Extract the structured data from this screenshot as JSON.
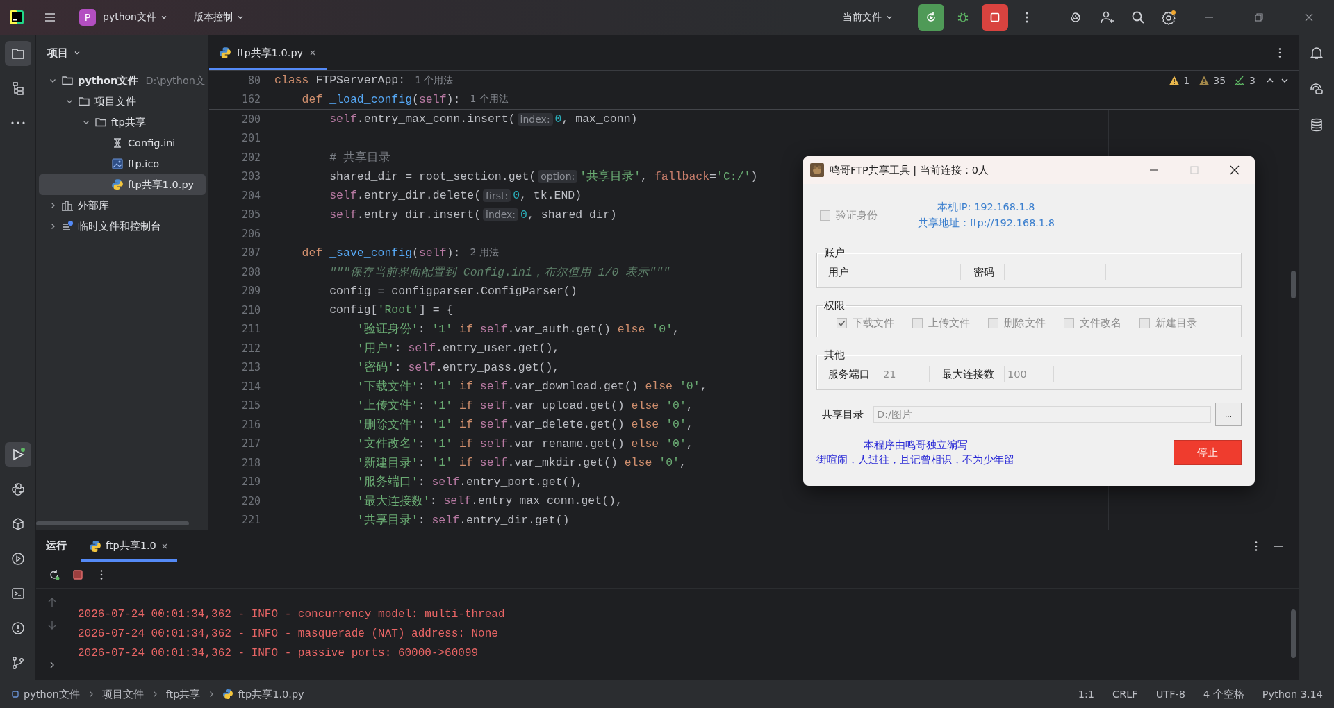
{
  "topbar": {
    "project_badge": "P",
    "project": "python文件",
    "vcs": "版本控制",
    "run_config": "当前文件"
  },
  "project_panel": {
    "title": "项目",
    "tree": [
      {
        "label": "python文件",
        "path": "D:\\python文",
        "kind": "folder",
        "bold": true,
        "expanded": true,
        "selected": false,
        "children": [
          {
            "label": "项目文件",
            "kind": "folder",
            "expanded": true,
            "selected": false,
            "children": [
              {
                "label": "ftp共享",
                "kind": "folder",
                "expanded": true,
                "selected": false,
                "children": [
                  {
                    "label": "Config.ini",
                    "kind": "ini",
                    "selected": false
                  },
                  {
                    "label": "ftp.ico",
                    "kind": "image",
                    "selected": false
                  },
                  {
                    "label": "ftp共享1.0.py",
                    "kind": "python",
                    "selected": true
                  }
                ]
              }
            ]
          }
        ]
      },
      {
        "label": "外部库",
        "kind": "library",
        "expanded": false,
        "selected": false
      },
      {
        "label": "临时文件和控制台",
        "kind": "scratch",
        "expanded": false,
        "selected": false
      }
    ]
  },
  "editor": {
    "tabs": [
      {
        "label": "ftp共享1.0.py",
        "selected": true
      }
    ],
    "inspections": {
      "errors": "1",
      "warnings": "35",
      "typos": "3"
    },
    "sticky_lines": [
      {
        "number": "80",
        "tokens": [
          {
            "kind": "kw",
            "text": "class"
          },
          {
            "kind": "plain",
            "text": " FTPServerApp:"
          },
          {
            "kind": "usage",
            "text": "1 个用法"
          }
        ]
      },
      {
        "number": "162",
        "tokens": [
          {
            "kind": "kw",
            "text": "    def "
          },
          {
            "kind": "fn",
            "text": "_load_config"
          },
          {
            "kind": "plain",
            "text": "("
          },
          {
            "kind": "self",
            "text": "self"
          },
          {
            "kind": "plain",
            "text": "):"
          },
          {
            "kind": "usage",
            "text": "1 个用法"
          }
        ]
      }
    ],
    "lines": [
      {
        "number": "200",
        "tokens": [
          {
            "kind": "self",
            "text": "        self"
          },
          {
            "kind": "plain",
            "text": ".entry_max_conn.insert("
          },
          {
            "kind": "hint",
            "text": "index:"
          },
          {
            "kind": "num",
            "text": "0"
          },
          {
            "kind": "plain",
            "text": ", max_conn)"
          }
        ]
      },
      {
        "number": "201"
      },
      {
        "number": "202",
        "tokens": [
          {
            "kind": "comment",
            "text": "        # 共享目录"
          }
        ]
      },
      {
        "number": "203",
        "tokens": [
          {
            "kind": "plain",
            "text": "        shared_dir = root_section.get("
          },
          {
            "kind": "hint",
            "text": "option:"
          },
          {
            "kind": "str",
            "text": "'共享目录'"
          },
          {
            "kind": "plain",
            "text": ", "
          },
          {
            "kind": "param",
            "text": "fallback"
          },
          {
            "kind": "plain",
            "text": "="
          },
          {
            "kind": "str",
            "text": "'C:/'"
          },
          {
            "kind": "plain",
            "text": ")"
          }
        ]
      },
      {
        "number": "204",
        "tokens": [
          {
            "kind": "self",
            "text": "        self"
          },
          {
            "kind": "plain",
            "text": ".entry_dir.delete("
          },
          {
            "kind": "hint",
            "text": "first:"
          },
          {
            "kind": "num",
            "text": "0"
          },
          {
            "kind": "plain",
            "text": ", tk.END)"
          }
        ]
      },
      {
        "number": "205",
        "tokens": [
          {
            "kind": "self",
            "text": "        self"
          },
          {
            "kind": "plain",
            "text": ".entry_dir.insert("
          },
          {
            "kind": "hint",
            "text": "index:"
          },
          {
            "kind": "num",
            "text": "0"
          },
          {
            "kind": "plain",
            "text": ", shared_dir)"
          }
        ]
      },
      {
        "number": "206"
      },
      {
        "number": "207",
        "tokens": [
          {
            "kind": "kw",
            "text": "    def "
          },
          {
            "kind": "fn",
            "text": "_save_config"
          },
          {
            "kind": "plain",
            "text": "("
          },
          {
            "kind": "self",
            "text": "self"
          },
          {
            "kind": "plain",
            "text": "):"
          },
          {
            "kind": "usage",
            "text": "2 用法"
          }
        ]
      },
      {
        "number": "208",
        "tokens": [
          {
            "kind": "doc",
            "text": "        \"\"\"保存当前界面配置到 Config.ini，布尔值用 1/0 表示\"\"\""
          }
        ]
      },
      {
        "number": "209",
        "tokens": [
          {
            "kind": "plain",
            "text": "        config = configparser.ConfigParser()"
          }
        ]
      },
      {
        "number": "210",
        "tokens": [
          {
            "kind": "plain",
            "text": "        config["
          },
          {
            "kind": "str",
            "text": "'Root'"
          },
          {
            "kind": "plain",
            "text": "] = {"
          }
        ]
      },
      {
        "number": "211",
        "tokens": [
          {
            "kind": "str",
            "text": "            '验证身份'"
          },
          {
            "kind": "plain",
            "text": ": "
          },
          {
            "kind": "str",
            "text": "'1'"
          },
          {
            "kind": "kw",
            "text": " if "
          },
          {
            "kind": "self",
            "text": "self"
          },
          {
            "kind": "plain",
            "text": ".var_auth.get()"
          },
          {
            "kind": "kw",
            "text": " else "
          },
          {
            "kind": "str",
            "text": "'0'"
          },
          {
            "kind": "plain",
            "text": ","
          }
        ]
      },
      {
        "number": "212",
        "tokens": [
          {
            "kind": "str",
            "text": "            '用户'"
          },
          {
            "kind": "plain",
            "text": ": "
          },
          {
            "kind": "self",
            "text": "self"
          },
          {
            "kind": "plain",
            "text": ".entry_user.get(),"
          }
        ]
      },
      {
        "number": "213",
        "tokens": [
          {
            "kind": "str",
            "text": "            '密码'"
          },
          {
            "kind": "plain",
            "text": ": "
          },
          {
            "kind": "self",
            "text": "self"
          },
          {
            "kind": "plain",
            "text": ".entry_pass.get(),"
          }
        ]
      },
      {
        "number": "214",
        "tokens": [
          {
            "kind": "str",
            "text": "            '下载文件'"
          },
          {
            "kind": "plain",
            "text": ": "
          },
          {
            "kind": "str",
            "text": "'1'"
          },
          {
            "kind": "kw",
            "text": " if "
          },
          {
            "kind": "self",
            "text": "self"
          },
          {
            "kind": "plain",
            "text": ".var_download.get()"
          },
          {
            "kind": "kw",
            "text": " else "
          },
          {
            "kind": "str",
            "text": "'0'"
          },
          {
            "kind": "plain",
            "text": ","
          }
        ]
      },
      {
        "number": "215",
        "tokens": [
          {
            "kind": "str",
            "text": "            '上传文件'"
          },
          {
            "kind": "plain",
            "text": ": "
          },
          {
            "kind": "str",
            "text": "'1'"
          },
          {
            "kind": "kw",
            "text": " if "
          },
          {
            "kind": "self",
            "text": "self"
          },
          {
            "kind": "plain",
            "text": ".var_upload.get()"
          },
          {
            "kind": "kw",
            "text": " else "
          },
          {
            "kind": "str",
            "text": "'0'"
          },
          {
            "kind": "plain",
            "text": ","
          }
        ]
      },
      {
        "number": "216",
        "tokens": [
          {
            "kind": "str",
            "text": "            '删除文件'"
          },
          {
            "kind": "plain",
            "text": ": "
          },
          {
            "kind": "str",
            "text": "'1'"
          },
          {
            "kind": "kw",
            "text": " if "
          },
          {
            "kind": "self",
            "text": "self"
          },
          {
            "kind": "plain",
            "text": ".var_delete.get()"
          },
          {
            "kind": "kw",
            "text": " else "
          },
          {
            "kind": "str",
            "text": "'0'"
          },
          {
            "kind": "plain",
            "text": ","
          }
        ]
      },
      {
        "number": "217",
        "tokens": [
          {
            "kind": "str",
            "text": "            '文件改名'"
          },
          {
            "kind": "plain",
            "text": ": "
          },
          {
            "kind": "str",
            "text": "'1'"
          },
          {
            "kind": "kw",
            "text": " if "
          },
          {
            "kind": "self",
            "text": "self"
          },
          {
            "kind": "plain",
            "text": ".var_rename.get()"
          },
          {
            "kind": "kw",
            "text": " else "
          },
          {
            "kind": "str",
            "text": "'0'"
          },
          {
            "kind": "plain",
            "text": ","
          }
        ]
      },
      {
        "number": "218",
        "tokens": [
          {
            "kind": "str",
            "text": "            '新建目录'"
          },
          {
            "kind": "plain",
            "text": ": "
          },
          {
            "kind": "str",
            "text": "'1'"
          },
          {
            "kind": "kw",
            "text": " if "
          },
          {
            "kind": "self",
            "text": "self"
          },
          {
            "kind": "plain",
            "text": ".var_mkdir.get()"
          },
          {
            "kind": "kw",
            "text": " else "
          },
          {
            "kind": "str",
            "text": "'0'"
          },
          {
            "kind": "plain",
            "text": ","
          }
        ]
      },
      {
        "number": "219",
        "tokens": [
          {
            "kind": "str",
            "text": "            '服务端口'"
          },
          {
            "kind": "plain",
            "text": ": "
          },
          {
            "kind": "self",
            "text": "self"
          },
          {
            "kind": "plain",
            "text": ".entry_port.get(),"
          }
        ]
      },
      {
        "number": "220",
        "tokens": [
          {
            "kind": "str",
            "text": "            '最大连接数'"
          },
          {
            "kind": "plain",
            "text": ": "
          },
          {
            "kind": "self",
            "text": "self"
          },
          {
            "kind": "plain",
            "text": ".entry_max_conn.get(),"
          }
        ]
      },
      {
        "number": "221",
        "tokens": [
          {
            "kind": "str",
            "text": "            '共享目录'"
          },
          {
            "kind": "plain",
            "text": ": "
          },
          {
            "kind": "self",
            "text": "self"
          },
          {
            "kind": "plain",
            "text": ".entry_dir.get()"
          }
        ]
      }
    ]
  },
  "dialog": {
    "title": "鸣哥FTP共享工具 | 当前连接：0人",
    "controls_disabled": true,
    "auth": {
      "label": "验证身份",
      "checked": false
    },
    "local_ip": "本机IP: 192.168.1.8",
    "share_address": "共享地址：ftp://192.168.1.8",
    "account": {
      "title": "账户",
      "user_label": "用户",
      "password_label": "密码"
    },
    "permissions": {
      "title": "权限",
      "items": [
        {
          "label": "下载文件",
          "checked": true
        },
        {
          "label": "上传文件",
          "checked": false
        },
        {
          "label": "删除文件",
          "checked": false
        },
        {
          "label": "文件改名",
          "checked": false
        },
        {
          "label": "新建目录",
          "checked": false
        }
      ]
    },
    "other": {
      "title": "其他",
      "port_label": "服务端口",
      "port": "21",
      "max_conn_label": "最大连接数",
      "max_conn": "100"
    },
    "share_dir": {
      "label": "共享目录",
      "value": "D:/图片",
      "browse": "..."
    },
    "credits": [
      "本程序由鸣哥独立编写",
      "街喧闹，人过往，且记曾相识，不为少年留"
    ],
    "stop_button": "停止"
  },
  "run_panel": {
    "title": "运行",
    "tabs": [
      {
        "label": "ftp共享1.0",
        "selected": true
      }
    ],
    "log": [
      "2026-07-24 00:01:34,362 - INFO - concurrency model: multi-thread",
      "2026-07-24 00:01:34,362 - INFO - masquerade (NAT) address: None",
      "2026-07-24 00:01:34,362 - INFO - passive ports: 60000->60099"
    ]
  },
  "status_bar": {
    "breadcrumbs": [
      "python文件",
      "项目文件",
      "ftp共享",
      "ftp共享1.0.py"
    ],
    "items": [
      "1:1",
      "CRLF",
      "UTF-8",
      "4 个空格",
      "Python 3.14"
    ]
  }
}
